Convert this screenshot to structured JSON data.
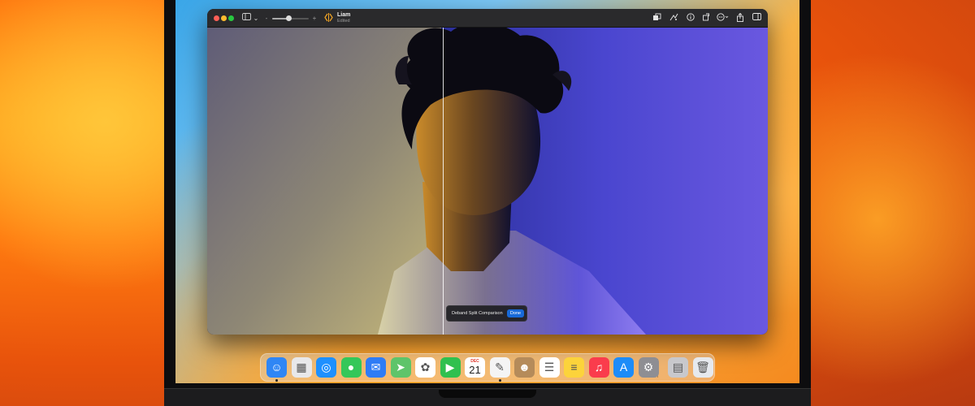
{
  "window": {
    "title": "Liam",
    "subtitle": "Edited"
  },
  "toolbar": {
    "icons": [
      "sidebar-icon",
      "chevron-down-icon",
      "zoom-out-icon",
      "zoom-slider",
      "zoom-in-icon",
      "compare-icon",
      "enhance-icon",
      "adjust-icon",
      "info-icon",
      "rotate-icon",
      "more-icon",
      "share-icon",
      "panel-icon"
    ],
    "zoom_level": 0.45
  },
  "comparison": {
    "label": "Deband Split Comparison",
    "done_label": "Done",
    "split_position": 0.42
  },
  "dock": {
    "apps": [
      {
        "name": "Finder",
        "icon": "finder-icon",
        "color": "#2f86f5",
        "glyph": "☺",
        "running": true
      },
      {
        "name": "Launchpad",
        "icon": "launchpad-icon",
        "color": "#e8e8ea",
        "glyph": "▦",
        "running": false
      },
      {
        "name": "Safari",
        "icon": "safari-icon",
        "color": "#1e90ff",
        "glyph": "◎",
        "running": false
      },
      {
        "name": "Messages",
        "icon": "messages-icon",
        "color": "#34c759",
        "glyph": "●",
        "running": false
      },
      {
        "name": "Mail",
        "icon": "mail-icon",
        "color": "#2e7cf6",
        "glyph": "✉",
        "running": false
      },
      {
        "name": "Maps",
        "icon": "maps-icon",
        "color": "#5ec46a",
        "glyph": "➤",
        "running": false
      },
      {
        "name": "Photos",
        "icon": "photos-icon",
        "color": "#ffffff",
        "glyph": "✿",
        "running": false
      },
      {
        "name": "FaceTime",
        "icon": "facetime-icon",
        "color": "#30c04f",
        "glyph": "▶",
        "running": false
      },
      {
        "name": "Calendar",
        "icon": "calendar-icon",
        "color": "#ffffff",
        "month": "DEC",
        "day": "21",
        "running": false
      },
      {
        "name": "Pixelmator Pro",
        "icon": "pixelmator-icon",
        "color": "#f4f4f4",
        "glyph": "✎",
        "running": true
      },
      {
        "name": "Contacts",
        "icon": "contacts-icon",
        "color": "#b58b5a",
        "glyph": "☻",
        "running": false
      },
      {
        "name": "Reminders",
        "icon": "reminders-icon",
        "color": "#ffffff",
        "glyph": "☰",
        "running": false
      },
      {
        "name": "Notes",
        "icon": "notes-icon",
        "color": "#fcd33b",
        "glyph": "≡",
        "running": false
      },
      {
        "name": "Music",
        "icon": "music-icon",
        "color": "#fa3c4c",
        "glyph": "♫",
        "running": false
      },
      {
        "name": "App Store",
        "icon": "app-store-icon",
        "color": "#1d8cf8",
        "glyph": "A",
        "running": false
      },
      {
        "name": "System Settings",
        "icon": "settings-icon",
        "color": "#8e8e93",
        "glyph": "⚙",
        "running": false
      },
      {
        "name": "Downloads",
        "icon": "downloads-stack-icon",
        "color": "#c8c8cc",
        "glyph": "▤",
        "running": false
      },
      {
        "name": "Trash",
        "icon": "trash-icon",
        "color": "#e6e9ee",
        "glyph": "🗑",
        "running": false
      }
    ]
  }
}
